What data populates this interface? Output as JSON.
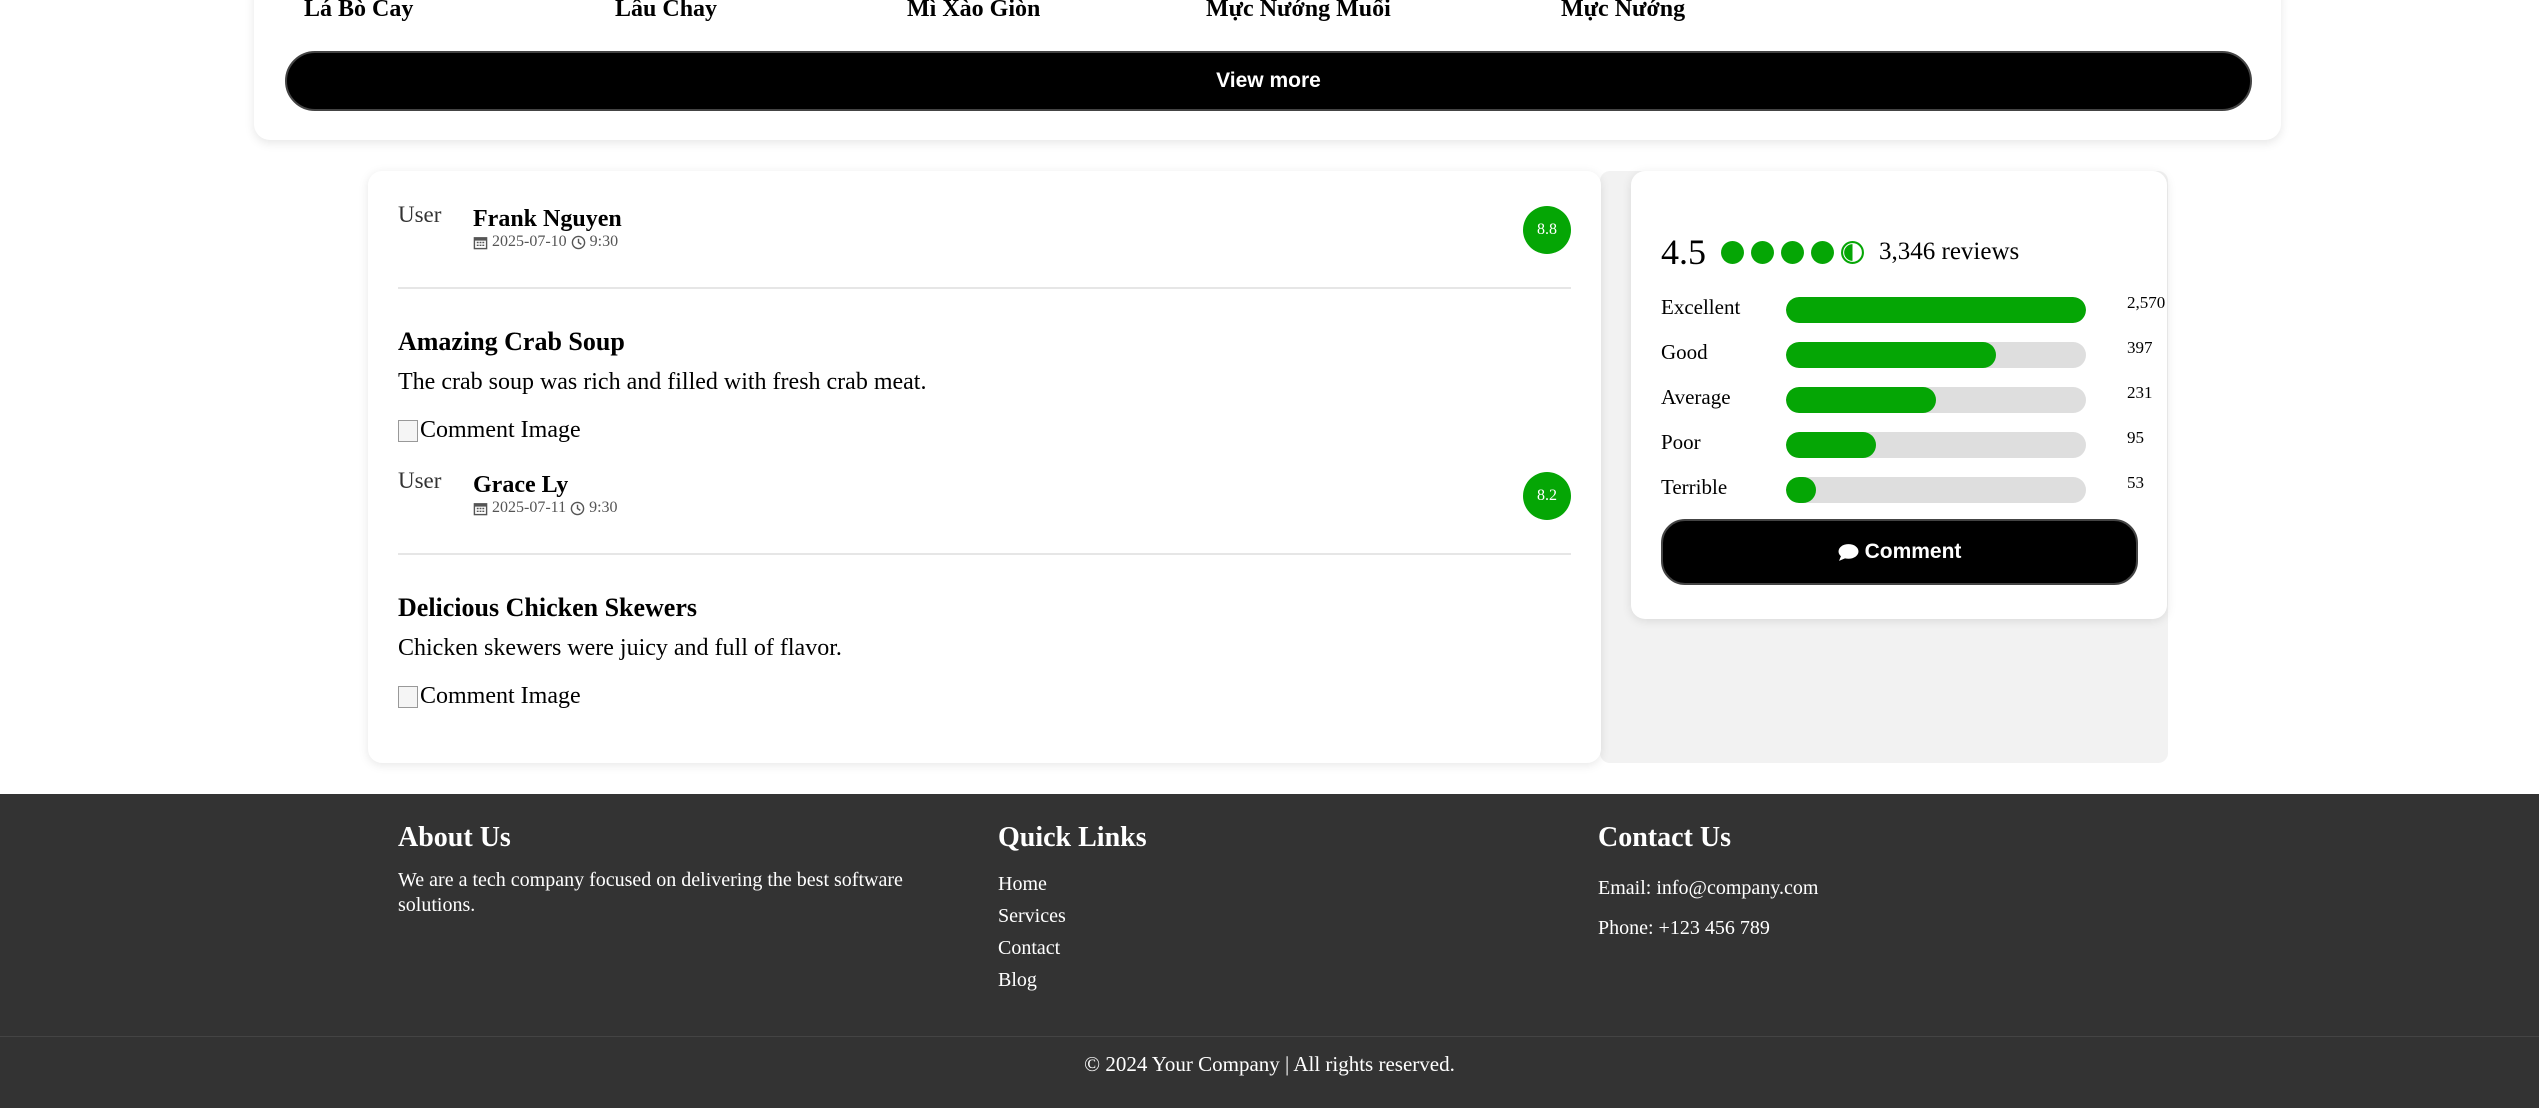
{
  "menu": {
    "dishes": [
      "Lá Bò Cay",
      "Lâu Chay",
      "Mì Xào Giòn",
      "Mực Nướng Muối",
      "Mực Nướng"
    ],
    "view_more_label": "View more"
  },
  "reviews": [
    {
      "avatar_alt": "User",
      "user": "Frank Nguyen",
      "date": "2025-07-10",
      "time": "9:30",
      "score": "8.8",
      "title": "Amazing Crab Soup",
      "text": "The crab soup was rich and filled with fresh crab meat.",
      "image_alt": "Comment Image"
    },
    {
      "avatar_alt": "User",
      "user": "Grace Ly",
      "date": "2025-07-11",
      "time": "9:30",
      "score": "8.2",
      "title": "Delicious Chicken Skewers",
      "text": "Chicken skewers were juicy and full of flavor.",
      "image_alt": "Comment Image"
    }
  ],
  "rating": {
    "average": "4.5",
    "stars": [
      1,
      1,
      1,
      1,
      0.5
    ],
    "review_count": "3,346 reviews",
    "breakdown": [
      {
        "label": "Excellent",
        "count": "2,570",
        "fraction": 1.0
      },
      {
        "label": "Good",
        "count": "397",
        "fraction": 0.7
      },
      {
        "label": "Average",
        "count": "231",
        "fraction": 0.5
      },
      {
        "label": "Poor",
        "count": "95",
        "fraction": 0.3
      },
      {
        "label": "Terrible",
        "count": "53",
        "fraction": 0.1
      }
    ],
    "comment_label": "Comment",
    "accent_color": "#05a605"
  },
  "footer": {
    "about": {
      "heading": "About Us",
      "text": "We are a tech company focused on delivering the best software solutions."
    },
    "quick_links": {
      "heading": "Quick Links",
      "links": [
        "Home",
        "Services",
        "Contact",
        "Blog"
      ]
    },
    "contact": {
      "heading": "Contact Us",
      "email": "Email: info@company.com",
      "phone": "Phone: +123 456 789"
    },
    "copyright": "© 2024 Your Company | All rights reserved."
  }
}
